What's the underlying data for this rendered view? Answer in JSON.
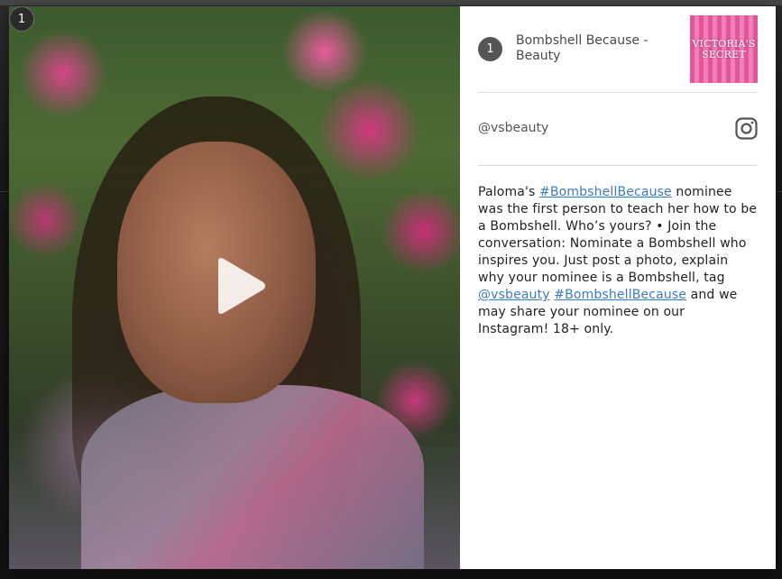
{
  "modal": {
    "counter": "1"
  },
  "media": {
    "kind": "video",
    "play_icon": "play-icon"
  },
  "post": {
    "index": "1",
    "title": "Bombshell Because - Beauty",
    "brand_logo_text": "VICTORIA'S SECRET",
    "handle": "@vsbeauty",
    "platform_icon": "instagram-icon",
    "caption": {
      "part1": "Paloma's ",
      "hashtag1": "#BombshellBecause",
      "part2": " nominee was the first person to teach her how to be a Bombshell. Who’s yours? • Join the conversation: Nominate a Bombshell who inspires you. Just post a photo, explain why your nominee is a Bombshell, tag ",
      "mention": "@vsbeauty",
      "space": " ",
      "hashtag2": "#BombshellBecause",
      "part3": " and we may share your nominee on our Instagram! 18+ only."
    }
  },
  "colors": {
    "link": "#3a7bc8",
    "logo_pink": "#e0569a",
    "badge_gray": "#555555"
  }
}
